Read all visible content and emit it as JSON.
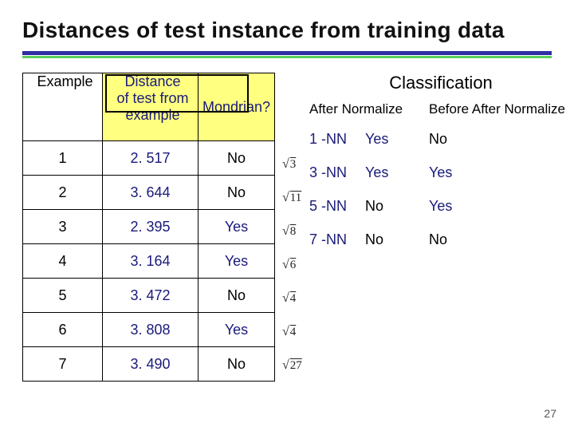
{
  "title": "Distances of test instance from training data",
  "left": {
    "example_hdr": "Example",
    "dist_hdr_l1": "Distance",
    "dist_hdr_l2": "of test from",
    "dist_hdr_l3": "example",
    "mondrian_hdr": "Mondrian?",
    "rows": [
      {
        "ex": "1",
        "dist": "2. 517",
        "mon": "No",
        "sqrt": "3"
      },
      {
        "ex": "2",
        "dist": "3. 644",
        "mon": "No",
        "sqrt": "11"
      },
      {
        "ex": "3",
        "dist": "2. 395",
        "mon": "Yes",
        "sqrt": "8"
      },
      {
        "ex": "4",
        "dist": "3. 164",
        "mon": "Yes",
        "sqrt": "6"
      },
      {
        "ex": "5",
        "dist": "3. 472",
        "mon": "No",
        "sqrt": "4"
      },
      {
        "ex": "6",
        "dist": "3. 808",
        "mon": "Yes",
        "sqrt": "4"
      },
      {
        "ex": "7",
        "dist": "3. 490",
        "mon": "No",
        "sqrt": "27"
      }
    ]
  },
  "right": {
    "header": "Classification",
    "col_a": "After Normalize",
    "col_b": "Before After Normalize",
    "rows": [
      {
        "k": "1 -NN",
        "a": "Yes",
        "b": "No",
        "a_navy": true,
        "b_navy": false
      },
      {
        "k": "3 -NN",
        "a": "Yes",
        "b": "Yes",
        "a_navy": true,
        "b_navy": true
      },
      {
        "k": "5 -NN",
        "a": "No",
        "b": "Yes",
        "a_navy": false,
        "b_navy": true
      },
      {
        "k": "7 -NN",
        "a": "No",
        "b": "No",
        "a_navy": false,
        "b_navy": false
      }
    ]
  },
  "page_num": "27"
}
